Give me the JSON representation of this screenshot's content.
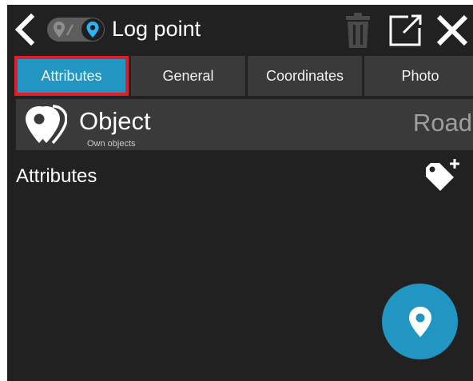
{
  "header": {
    "title": "Log point",
    "icons": {
      "back": "chevron-left-icon",
      "mode_off": "map-marker-slash-icon",
      "mode_on": "map-marker-icon",
      "delete": "trash-icon",
      "popout": "external-window-icon",
      "close": "close-icon"
    }
  },
  "tabs": [
    {
      "label": "Attributes",
      "selected": true
    },
    {
      "label": "General",
      "selected": false
    },
    {
      "label": "Coordinates",
      "selected": false
    },
    {
      "label": "Photo",
      "selected": false
    }
  ],
  "object": {
    "title": "Object",
    "subtitle": "Own objects",
    "type": "Road",
    "icon": "stacked-markers-icon"
  },
  "attributes": {
    "label": "Attributes",
    "add_icon": "add-tag-icon"
  },
  "fab": {
    "icon": "map-marker-icon"
  },
  "colors": {
    "background": "#212121",
    "accent": "#2196c3",
    "tab_bg": "#3a3a3a",
    "highlight": "#e01e2a"
  }
}
